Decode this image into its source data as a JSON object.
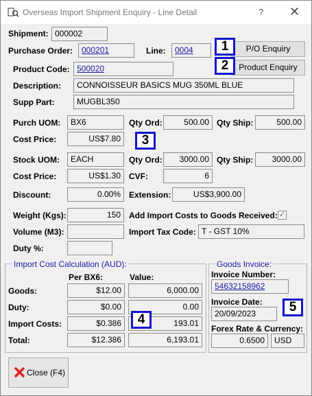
{
  "window": {
    "title": "Overseas Import Shipment Enquiry - Line Detail",
    "help": "?",
    "close": "✕"
  },
  "header": {
    "shipment_label": "Shipment:",
    "shipment": "000002",
    "po_label": "Purchase Order:",
    "po": "000201",
    "line_label": "Line:",
    "line": "0004",
    "po_enquiry_button": "P/O Enquiry",
    "product_code_label": "Product Code:",
    "product_code": "500020",
    "product_enquiry_button": "Product Enquiry",
    "description_label": "Description:",
    "description": "CONNOISSEUR BASICS MUG 350ML BLUE",
    "supp_part_label": "Supp Part:",
    "supp_part": "MUGBL350"
  },
  "purch": {
    "uom_label": "Purch UOM:",
    "uom": "BX6",
    "qty_ord_label": "Qty Ord:",
    "qty_ord": "500.00",
    "qty_ship_label": "Qty Ship:",
    "qty_ship": "500.00",
    "cost_label": "Cost Price:",
    "cost": "US$7.80"
  },
  "stock": {
    "uom_label": "Stock UOM:",
    "uom": "EACH",
    "qty_ord_label": "Qty Ord:",
    "qty_ord": "3000.00",
    "qty_ship_label": "Qty Ship:",
    "qty_ship": "3000.00",
    "cost_label": "Cost Price:",
    "cost": "US$1.30",
    "cvf_label": "CVF:",
    "cvf": "6"
  },
  "misc": {
    "discount_label": "Discount:",
    "discount": "0.00%",
    "extension_label": "Extension:",
    "extension": "US$3,900.00",
    "weight_label": "Weight (Kgs):",
    "weight": "150",
    "add_import_label": "Add Import Costs to Goods Received:",
    "add_import_checked": true,
    "check_mark": "✓",
    "volume_label": "Volume (M3):",
    "volume": "",
    "import_tax_label": "Import Tax Code:",
    "import_tax": "T - GST 10%",
    "duty_label": "Duty %:",
    "duty": ""
  },
  "import_cost": {
    "title": "Import Cost Calculation (AUD):",
    "col_per": "Per BX6:",
    "col_value": "Value:",
    "rows": [
      {
        "label": "Goods:",
        "per": "$12.00",
        "value": "6,000.00"
      },
      {
        "label": "Duty:",
        "per": "$0.00",
        "value": "0.00"
      },
      {
        "label": "Import Costs:",
        "per": "$0.386",
        "value": "193.01"
      },
      {
        "label": "Total:",
        "per": "$12.386",
        "value": "6,193.01"
      }
    ]
  },
  "goods_invoice": {
    "title": "Goods Invoice:",
    "number_label": "Invoice Number:",
    "number": "54632158962",
    "date_label": "Invoice Date:",
    "date": "20/09/2023",
    "forex_label": "Forex Rate & Currency:",
    "forex_rate": "0.6500",
    "currency": "USD"
  },
  "badges": [
    "1",
    "2",
    "3",
    "4",
    "5"
  ],
  "footer": {
    "close_button": "Close (F4)"
  },
  "colors": {
    "link": "#1a1aa6",
    "badge_border": "#1414cc",
    "group_title": "#1a1aa6"
  }
}
